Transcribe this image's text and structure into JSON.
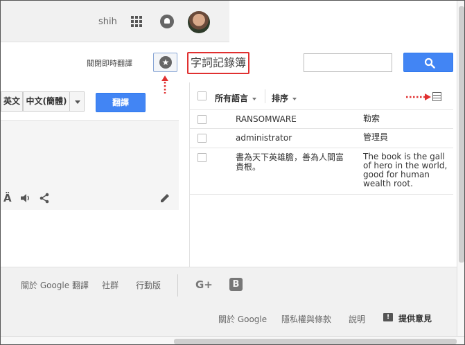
{
  "header": {
    "username": "shih",
    "instant_translate_off": "關閉即時翻譯",
    "phrasebook_title": "字詞記錄簿"
  },
  "languages": {
    "english": "英文",
    "chinese_simplified": "中文(簡體)"
  },
  "translate_button": "翻譯",
  "tools": {
    "font_glyph": "Ä"
  },
  "phrasebook": {
    "all_languages": "所有語言",
    "sort": "排序",
    "rows": [
      {
        "source": "RANSOMWARE",
        "translation": "勒索"
      },
      {
        "source": "administrator",
        "translation": "管理員"
      },
      {
        "source": "書為天下英雄膽，善為人間富貴根。",
        "translation": "The book is the gall of hero in the world, good for human wealth root."
      }
    ]
  },
  "footer": {
    "about_translate": "關於 Google 翻譯",
    "community": "社群",
    "mobile": "行動版",
    "about_google": "關於 Google",
    "privacy": "隱私權與條款",
    "help": "說明",
    "feedback": "提供意見"
  },
  "colors": {
    "accent_blue": "#4285f4",
    "highlight_red": "#e03030"
  }
}
